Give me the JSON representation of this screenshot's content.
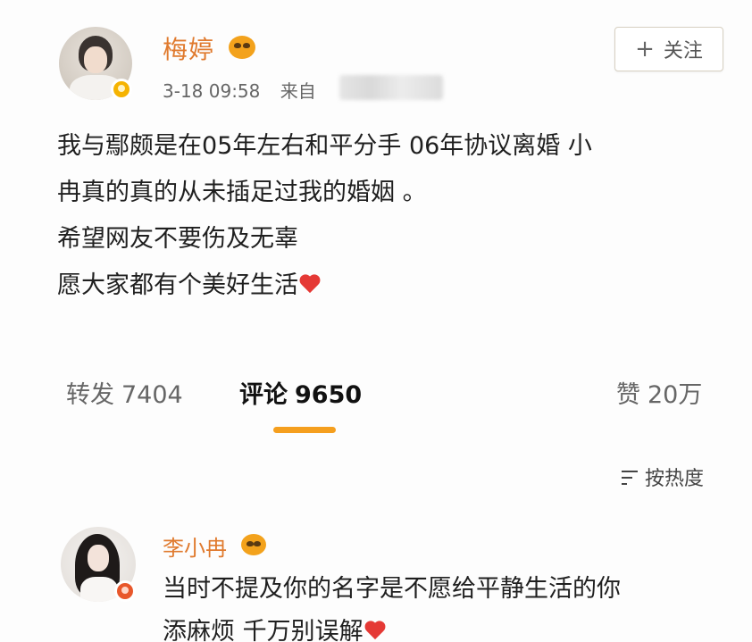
{
  "post": {
    "author_name": "梅婷",
    "time": "3-18 09:58",
    "source_prefix": "来自",
    "follow_plus": "+",
    "follow_label": "关注",
    "text_lines": [
      "我与鄢颇是在05年左右和平分手 06年协议离婚 小",
      "冉真的真的从未插足过我的婚姻 。",
      "希望网友不要伤及无辜",
      "愿大家都有个美好生活"
    ]
  },
  "stats": {
    "repost_label": "转发",
    "repost_count": "7404",
    "comment_label": "评论",
    "comment_count": "9650",
    "like_label": "赞",
    "like_count": "20万"
  },
  "sort": {
    "label": "按热度"
  },
  "comment": {
    "author_name": "李小冉",
    "text_lines": [
      "当时不提及你的名字是不愿给平静生活的你",
      "添麻烦 千万别误解"
    ]
  },
  "colors": {
    "name_orange": "#e07a2e",
    "tab_indicator": "#f59f1e",
    "heart_red": "#e53935"
  },
  "icons": [
    "vip-icon",
    "verified-badge-icon",
    "heart-icon",
    "sort-icon",
    "plus-icon"
  ]
}
